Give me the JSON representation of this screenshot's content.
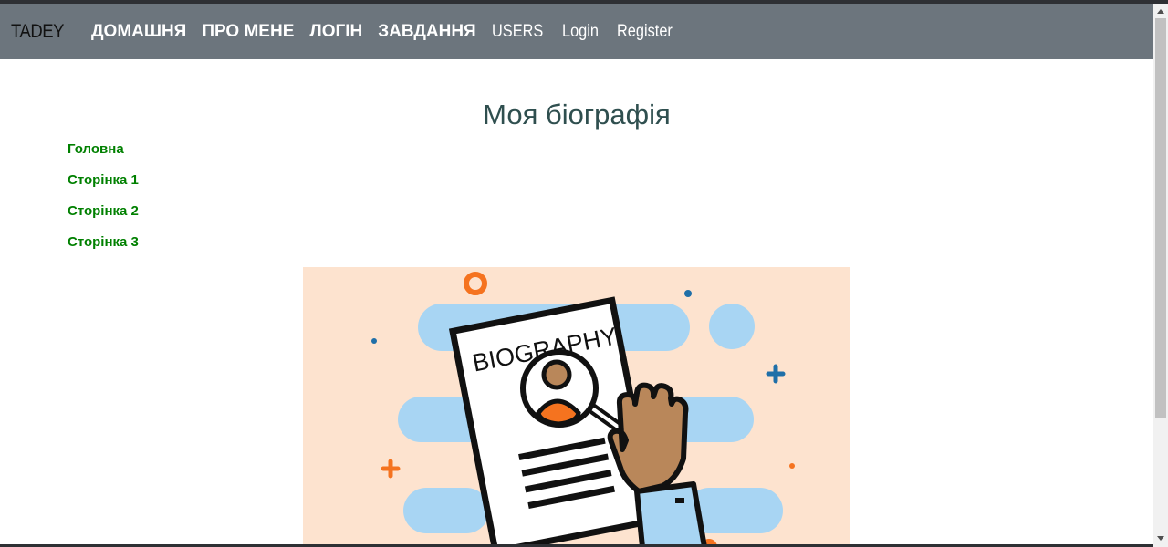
{
  "navbar": {
    "brand": "TADEY",
    "links": [
      {
        "label": "ДОМАШНЯ"
      },
      {
        "label": "ПРО МЕНЕ"
      },
      {
        "label": "ЛОГІН"
      },
      {
        "label": "ЗАВДАННЯ"
      },
      {
        "label": "USERS"
      },
      {
        "label": "Login"
      },
      {
        "label": "Register"
      }
    ]
  },
  "main": {
    "title": "Моя біографія",
    "side_menu": [
      {
        "label": "Головна"
      },
      {
        "label": "Сторінка 1"
      },
      {
        "label": "Сторінка 2"
      },
      {
        "label": "Сторінка 3"
      }
    ],
    "illustration": {
      "text": "BIOGRAPHY"
    }
  },
  "colors": {
    "navbar_bg": "#6c757d",
    "link_green": "#008000",
    "title": "#2f4f4f",
    "illustration_bg": "#fde3cf",
    "cloud_blue": "#a8d5f3",
    "accent_orange": "#f5731f",
    "accent_blue": "#1f6fa8",
    "skin": "#b9875a"
  }
}
